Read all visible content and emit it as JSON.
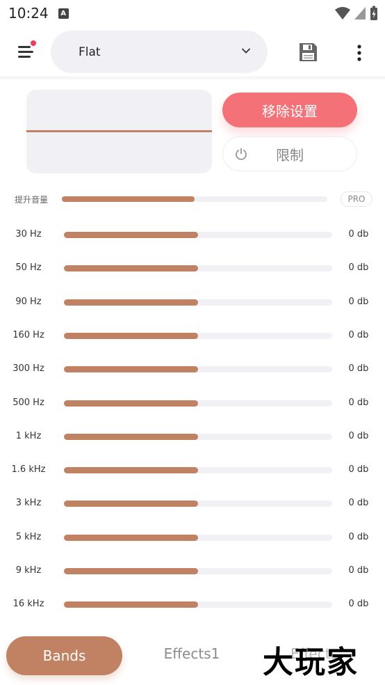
{
  "status": {
    "time": "10:24",
    "notif_icon": "A"
  },
  "preset": {
    "selected": "Flat"
  },
  "actions": {
    "remove_label": "移除设置",
    "limit_label": "限制"
  },
  "boost": {
    "label": "提升音量",
    "level": 0.5,
    "badge": "PRO"
  },
  "bands": [
    {
      "freq": "30 Hz",
      "value": "0 db",
      "level": 0.5
    },
    {
      "freq": "50 Hz",
      "value": "0 db",
      "level": 0.5
    },
    {
      "freq": "90 Hz",
      "value": "0 db",
      "level": 0.5
    },
    {
      "freq": "160 Hz",
      "value": "0 db",
      "level": 0.5
    },
    {
      "freq": "300 Hz",
      "value": "0 db",
      "level": 0.5
    },
    {
      "freq": "500 Hz",
      "value": "0 db",
      "level": 0.5
    },
    {
      "freq": "1 kHz",
      "value": "0 db",
      "level": 0.5
    },
    {
      "freq": "1.6 kHz",
      "value": "0 db",
      "level": 0.5
    },
    {
      "freq": "3 kHz",
      "value": "0 db",
      "level": 0.5
    },
    {
      "freq": "5 kHz",
      "value": "0 db",
      "level": 0.5
    },
    {
      "freq": "9 kHz",
      "value": "0 db",
      "level": 0.5
    },
    {
      "freq": "16 kHz",
      "value": "0 db",
      "level": 0.5
    }
  ],
  "tabs": {
    "bands": "Bands",
    "effects1": "Effects1",
    "effects2": "Effects"
  },
  "watermark": "大玩家",
  "colors": {
    "accent": "#c08262",
    "remove": "#f47178",
    "track": "#f0f0f5",
    "badge_dot": "#ef3e5c"
  }
}
